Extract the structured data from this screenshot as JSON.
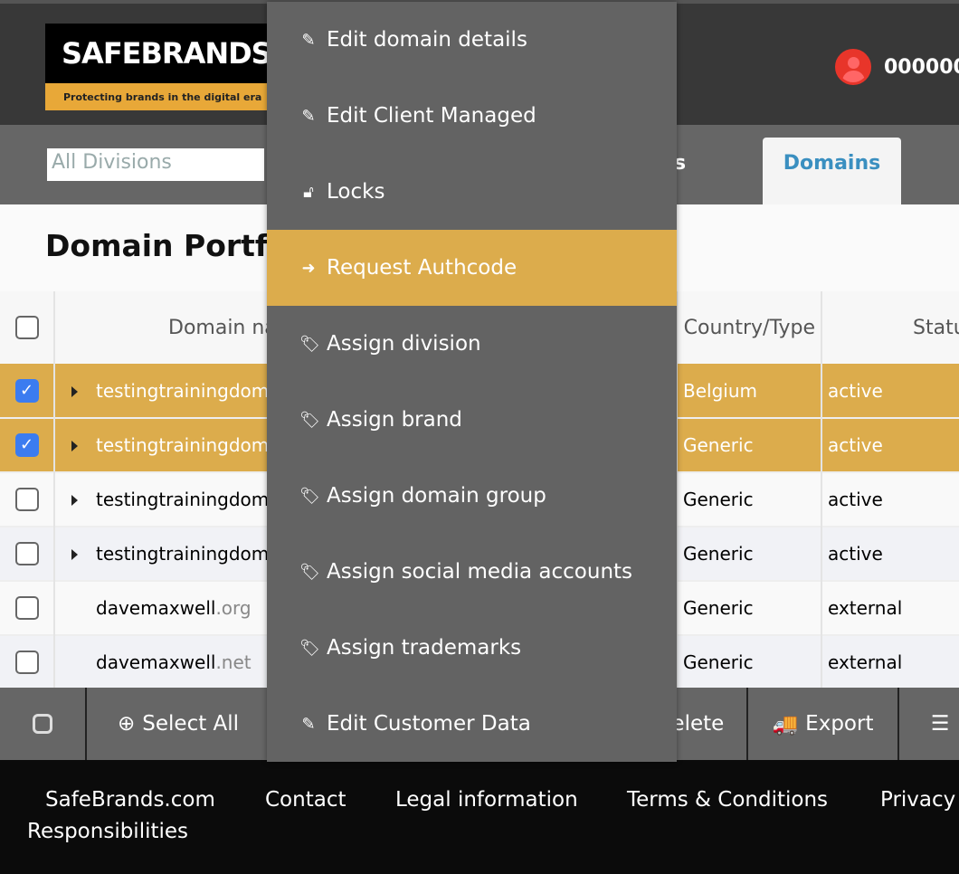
{
  "header": {
    "logo_text": "SafeBrands",
    "logo_tagline": "Protecting brands in the digital era",
    "user_id": "000000"
  },
  "nav": {
    "division_select": "All Divisions",
    "partial_tab": "s",
    "active_tab": "Domains"
  },
  "page_title": "Domain Portfolio",
  "table": {
    "columns": [
      "Domain name",
      "Country/Type",
      "Status"
    ],
    "rows": [
      {
        "checked": true,
        "expandable": true,
        "domain": "testingtrainingdomain",
        "tld": "",
        "country": "Belgium",
        "status": "active"
      },
      {
        "checked": true,
        "expandable": true,
        "domain": "testingtrainingdomain",
        "tld": "",
        "country": "Generic",
        "status": "active"
      },
      {
        "checked": false,
        "expandable": true,
        "domain": "testingtrainingdomain",
        "tld": "",
        "country": "Generic",
        "status": "active"
      },
      {
        "checked": false,
        "expandable": true,
        "domain": "testingtrainingdomain",
        "tld": "",
        "country": "Generic",
        "status": "active"
      },
      {
        "checked": false,
        "expandable": false,
        "domain": "davemaxwell",
        "tld": ".org",
        "country": "Generic",
        "status": "external"
      },
      {
        "checked": false,
        "expandable": false,
        "domain": "davemaxwell",
        "tld": ".net",
        "country": "Generic",
        "status": "external"
      }
    ]
  },
  "bottom_bar": {
    "select_all": "Select All",
    "delete": "Delete",
    "export": "Export"
  },
  "footer": {
    "links": [
      "SafeBrands.com",
      "Contact",
      "Legal information",
      "Terms & Conditions",
      "Privacy",
      "Responsibilities"
    ]
  },
  "menu": {
    "active_index": 3,
    "accent": "#dcac4c",
    "items": [
      {
        "icon": "pencil-icon",
        "label": "Edit domain details"
      },
      {
        "icon": "pencil-icon",
        "label": "Edit Client Managed"
      },
      {
        "icon": "unlock-icon",
        "label": "Locks"
      },
      {
        "icon": "sign-out-icon",
        "label": "Request Authcode"
      },
      {
        "icon": "tag-icon",
        "label": "Assign division"
      },
      {
        "icon": "tag-icon",
        "label": "Assign brand"
      },
      {
        "icon": "tag-icon",
        "label": "Assign domain group"
      },
      {
        "icon": "tag-icon",
        "label": "Assign social media accounts"
      },
      {
        "icon": "tag-icon",
        "label": "Assign trademarks"
      },
      {
        "icon": "pencil-icon",
        "label": "Edit Customer Data"
      }
    ]
  }
}
